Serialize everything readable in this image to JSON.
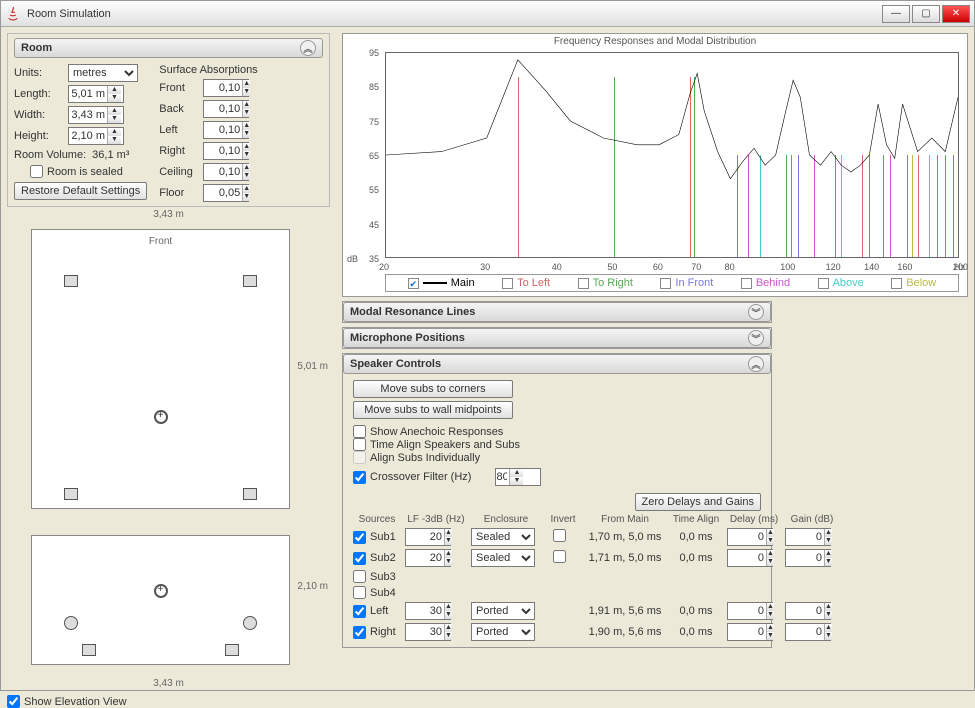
{
  "window": {
    "title": "Room Simulation"
  },
  "room_panel": {
    "header": "Room",
    "units_label": "Units:",
    "units_value": "metres",
    "length_label": "Length:",
    "length_value": "5,01 m",
    "width_label": "Width:",
    "width_value": "3,43 m",
    "height_label": "Height:",
    "height_value": "2,10 m",
    "volume_label": "Room Volume:",
    "volume_value": "36,1 m³",
    "sealed_label": "Room is sealed",
    "restore_btn": "Restore Default Settings",
    "absorb_header": "Surface Absorptions",
    "front_label": "Front",
    "front_val": "0,10",
    "back_label": "Back",
    "back_val": "0,10",
    "left_label": "Left",
    "left_val": "0,10",
    "right_label": "Right",
    "right_val": "0,10",
    "ceiling_label": "Ceiling",
    "ceiling_val": "0,10",
    "floor_label": "Floor",
    "floor_val": "0,05"
  },
  "plan": {
    "w": "3,43 m",
    "h": "5,01 m",
    "front": "Front"
  },
  "elev": {
    "w": "3,43 m",
    "h": "2,10 m"
  },
  "show_elev": "Show Elevation View",
  "chart": {
    "title": "Frequency Responses and Modal Distribution",
    "ylabel": "dB",
    "yticks": [
      "95",
      "85",
      "75",
      "65",
      "55",
      "45",
      "35"
    ],
    "xticks": [
      "20",
      "30",
      "40",
      "50",
      "60",
      "70",
      "80",
      "100",
      "120",
      "140",
      "160",
      "200"
    ],
    "xunit": "Hz",
    "legend": [
      "Main",
      "To Left",
      "To Right",
      "In Front",
      "Behind",
      "Above",
      "Below"
    ]
  },
  "chart_data": {
    "type": "line",
    "title": "Frequency Responses and Modal Distribution",
    "xlabel": "Hz",
    "ylabel": "dB",
    "xlim": [
      20,
      200
    ],
    "ylim": [
      35,
      95
    ],
    "xscale": "log",
    "series": [
      {
        "name": "Main",
        "x": [
          20,
          25,
          30,
          34,
          38,
          42,
          48,
          55,
          60,
          65,
          68,
          70,
          72,
          76,
          80,
          84,
          88,
          92,
          96,
          100,
          103,
          106,
          110,
          115,
          120,
          125,
          130,
          135,
          140,
          145,
          150,
          155,
          160,
          170,
          180,
          190,
          200
        ],
        "y": [
          65,
          66,
          70,
          93,
          84,
          75,
          70,
          68,
          68,
          71,
          83,
          89,
          78,
          66,
          58,
          63,
          67,
          62,
          65,
          78,
          87,
          82,
          65,
          62,
          66,
          62,
          60,
          62,
          65,
          80,
          68,
          64,
          80,
          66,
          70,
          66,
          82
        ]
      }
    ],
    "modal_lines": [
      {
        "freq": 34.0,
        "color": "#d66"
      },
      {
        "freq": 50.0,
        "color": "#5a5"
      },
      {
        "freq": 68.0,
        "color": "#d66"
      },
      {
        "freq": 69.0,
        "color": "#5a5"
      },
      {
        "freq": 82.0,
        "color": "#77d"
      },
      {
        "freq": 86.0,
        "color": "#c5c"
      },
      {
        "freq": 90.0,
        "color": "#4cc"
      },
      {
        "freq": 100.0,
        "color": "#5a5"
      },
      {
        "freq": 102.0,
        "color": "#d66"
      },
      {
        "freq": 105.0,
        "color": "#77d"
      },
      {
        "freq": 112.0,
        "color": "#c5c"
      },
      {
        "freq": 122.0,
        "color": "#5a5"
      },
      {
        "freq": 125.0,
        "color": "#4cc"
      },
      {
        "freq": 136.0,
        "color": "#d66"
      },
      {
        "freq": 140.0,
        "color": "#77d"
      },
      {
        "freq": 148.0,
        "color": "#5a5"
      },
      {
        "freq": 152.0,
        "color": "#c5c"
      },
      {
        "freq": 163.0,
        "color": "#77d"
      },
      {
        "freq": 166.0,
        "color": "#bb4"
      },
      {
        "freq": 170.0,
        "color": "#d66"
      },
      {
        "freq": 178.0,
        "color": "#4cc"
      },
      {
        "freq": 184.0,
        "color": "#c5c"
      },
      {
        "freq": 190.0,
        "color": "#5a5"
      },
      {
        "freq": 196.0,
        "color": "#77d"
      }
    ]
  },
  "acc": {
    "modal": "Modal Resonance Lines",
    "mic": "Microphone Positions",
    "speaker": "Speaker Controls"
  },
  "spk": {
    "move_corners": "Move subs to corners",
    "move_midpoints": "Move subs to wall midpoints",
    "anechoic": "Show Anechoic Responses",
    "time_align": "Time Align Speakers and Subs",
    "align_indiv": "Align Subs Individually",
    "crossover": "Crossover Filter (Hz)",
    "crossover_val": "80",
    "zero_btn": "Zero Delays and Gains",
    "hdr": {
      "sources": "Sources",
      "lf": "LF -3dB (Hz)",
      "enc": "Enclosure",
      "inv": "Invert",
      "from": "From Main",
      "ta": "Time Align",
      "delay": "Delay (ms)",
      "gain": "Gain (dB)"
    },
    "rows": [
      {
        "name": "Sub1",
        "checked": true,
        "lf": "20",
        "enc": "Sealed",
        "inv": true,
        "from": "1,70 m, 5,0 ms",
        "ta": "0,0 ms",
        "delay": "0",
        "gain": "0"
      },
      {
        "name": "Sub2",
        "checked": true,
        "lf": "20",
        "enc": "Sealed",
        "inv": true,
        "from": "1,71 m, 5,0 ms",
        "ta": "0,0 ms",
        "delay": "0",
        "gain": "0"
      },
      {
        "name": "Sub3",
        "checked": false
      },
      {
        "name": "Sub4",
        "checked": false
      },
      {
        "name": "Left",
        "checked": true,
        "lf": "30",
        "enc": "Ported",
        "inv": false,
        "from": "1,91 m, 5,6 ms",
        "ta": "0,0 ms",
        "delay": "0",
        "gain": "0"
      },
      {
        "name": "Right",
        "checked": true,
        "lf": "30",
        "enc": "Ported",
        "inv": false,
        "from": "1,90 m, 5,6 ms",
        "ta": "0,0 ms",
        "delay": "0",
        "gain": "0"
      }
    ]
  }
}
